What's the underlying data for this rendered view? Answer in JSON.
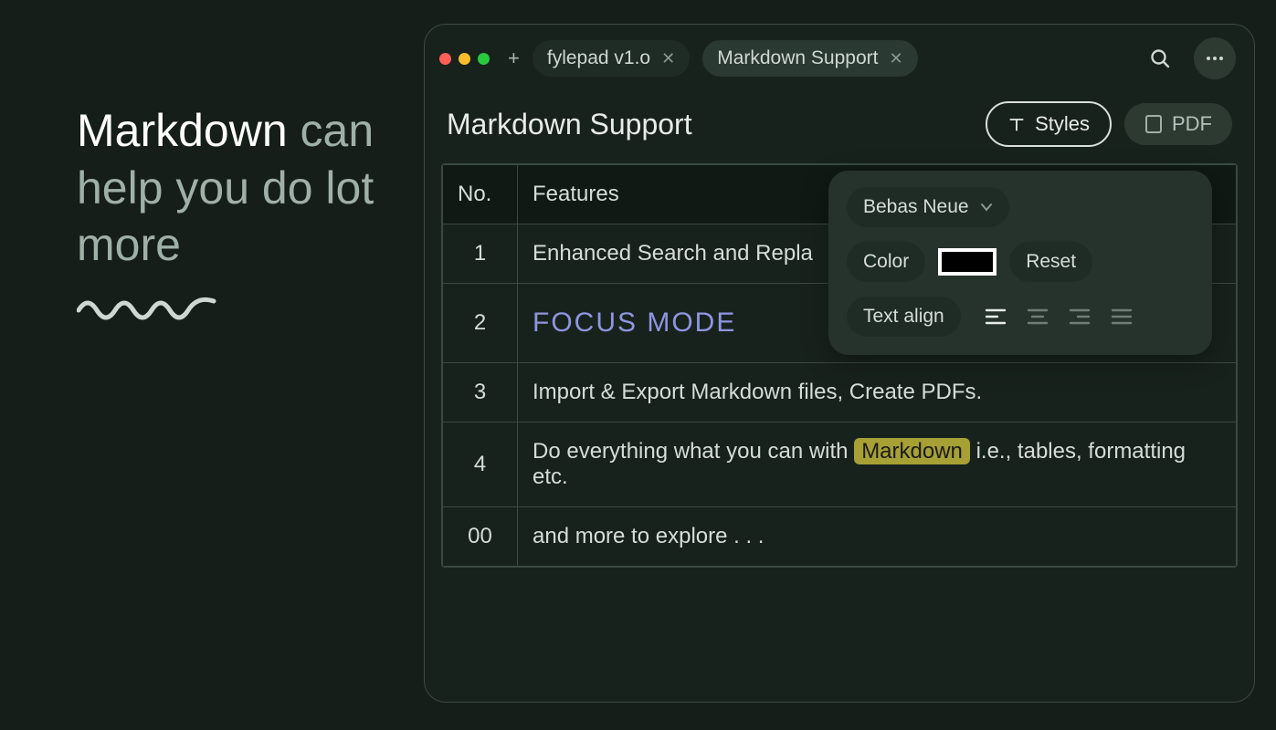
{
  "headline": {
    "strong": "Markdown",
    "rest": " can help you do lot more"
  },
  "tabs": [
    {
      "label": "fylepad v1.o"
    },
    {
      "label": "Markdown Support"
    }
  ],
  "doc": {
    "title": "Markdown Support"
  },
  "toolbar": {
    "styles_label": "Styles",
    "pdf_label": "PDF"
  },
  "table": {
    "headers": {
      "no": "No.",
      "features": "Features"
    },
    "rows": [
      {
        "no": "1",
        "feature": "Enhanced Search and Repla"
      },
      {
        "no": "2",
        "feature": "FOCUS MODE",
        "style": "focus"
      },
      {
        "no": "3",
        "feature": "Import & Export Markdown files, Create PDFs."
      },
      {
        "no": "4",
        "feature_pre": "Do everything what you can with ",
        "feature_chip": "Markdown",
        "feature_post": " i.e., tables, formatting etc."
      },
      {
        "no": "00",
        "feature": "and more to explore . . ."
      }
    ]
  },
  "styles_popover": {
    "font_label": "Bebas Neue",
    "color_label": "Color",
    "reset_label": "Reset",
    "text_align_label": "Text align"
  }
}
